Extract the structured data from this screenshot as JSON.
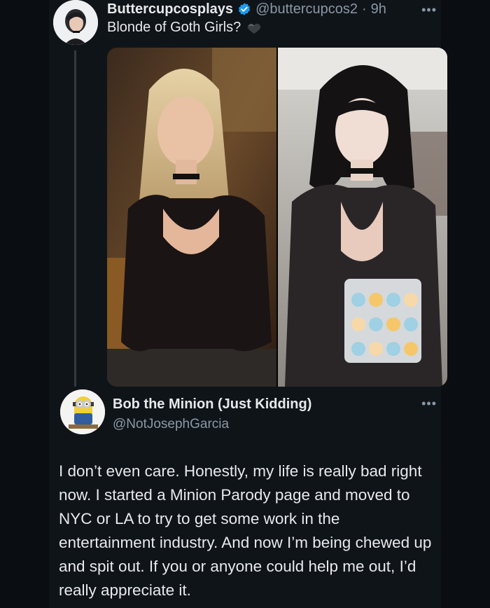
{
  "tweet": {
    "display_name": "Buttercupcosplays",
    "handle": "@buttercupcos2",
    "separator": "·",
    "time": "9h",
    "more_icon": "more-horizontal-icon",
    "text": "Blonde of Goth Girls?"
  },
  "reply": {
    "display_name": "Bob the Minion (Just Kidding)",
    "handle": "@NotJosephGarcia",
    "more_icon": "more-horizontal-icon",
    "text": "I don’t even care. Honestly, my life is really bad right now. I started a Minion Parody page and moved to NYC or LA to try to get some work in the entertainment industry. And now I’m being chewed up and spit out. If you or anyone could help me out, I’d really appreciate it."
  },
  "colors": {
    "background": "#0f1419",
    "text_primary": "#e7e9ea",
    "text_secondary": "#8b98a5",
    "verified": "#1d9bf0"
  }
}
